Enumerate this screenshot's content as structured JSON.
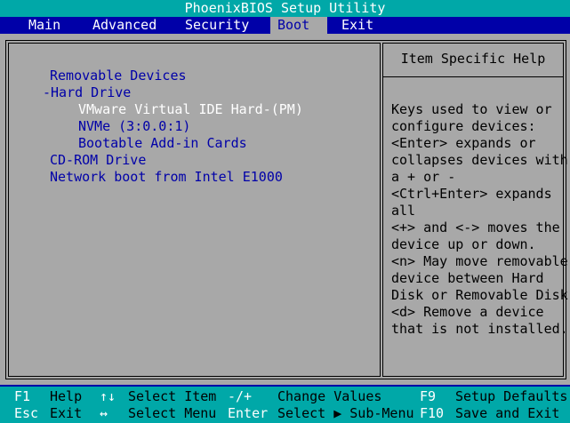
{
  "title": "PhoenixBIOS Setup Utility",
  "menu": {
    "main": "Main",
    "advanced": "Advanced",
    "security": "Security",
    "boot": "Boot",
    "exit": "Exit",
    "active": "Boot"
  },
  "boot_order": [
    {
      "label": "Removable Devices",
      "selected": false
    },
    {
      "label": "-Hard Drive",
      "selected": false
    },
    {
      "label": "VMware Virtual IDE Hard-(PM)",
      "selected": true
    },
    {
      "label": "NVMe (3:0.0:1)",
      "selected": false
    },
    {
      "label": "Bootable Add-in Cards",
      "selected": false
    },
    {
      "label": "CD-ROM Drive",
      "selected": false
    },
    {
      "label": "Network boot from Intel E1000",
      "selected": false
    }
  ],
  "help": {
    "title": "Item Specific Help",
    "lines": [
      "Keys used to view or",
      "configure devices:",
      "<Enter> expands or",
      "collapses devices with",
      "a + or -",
      "<Ctrl+Enter> expands",
      "all",
      "<+> and <-> moves the",
      "device up or down.",
      "<n> May move removable",
      "device between Hard",
      "Disk or Removable Disk",
      "<d> Remove a device",
      "that is not installed."
    ]
  },
  "footer": {
    "f1_key": "F1",
    "f1_desc": "Help",
    "updown_key": "↑↓",
    "updown_desc": "Select Item",
    "plusminus_key": "-/+",
    "plusminus_desc": "Change Values",
    "f9_key": "F9",
    "f9_desc": "Setup Defaults",
    "esc_key": "Esc",
    "esc_desc": "Exit",
    "leftright_key": "↔",
    "leftright_desc": "Select Menu",
    "enter_key": "Enter",
    "enter_desc": "Select ▶ Sub-Menu",
    "f10_key": "F10",
    "f10_desc": "Save and Exit"
  },
  "colors": {
    "background_blue": "#0000a8",
    "title_cyan": "#00a8a8",
    "panel_gray": "#a8a8a8",
    "text_white": "#ffffff",
    "text_black": "#000000"
  }
}
